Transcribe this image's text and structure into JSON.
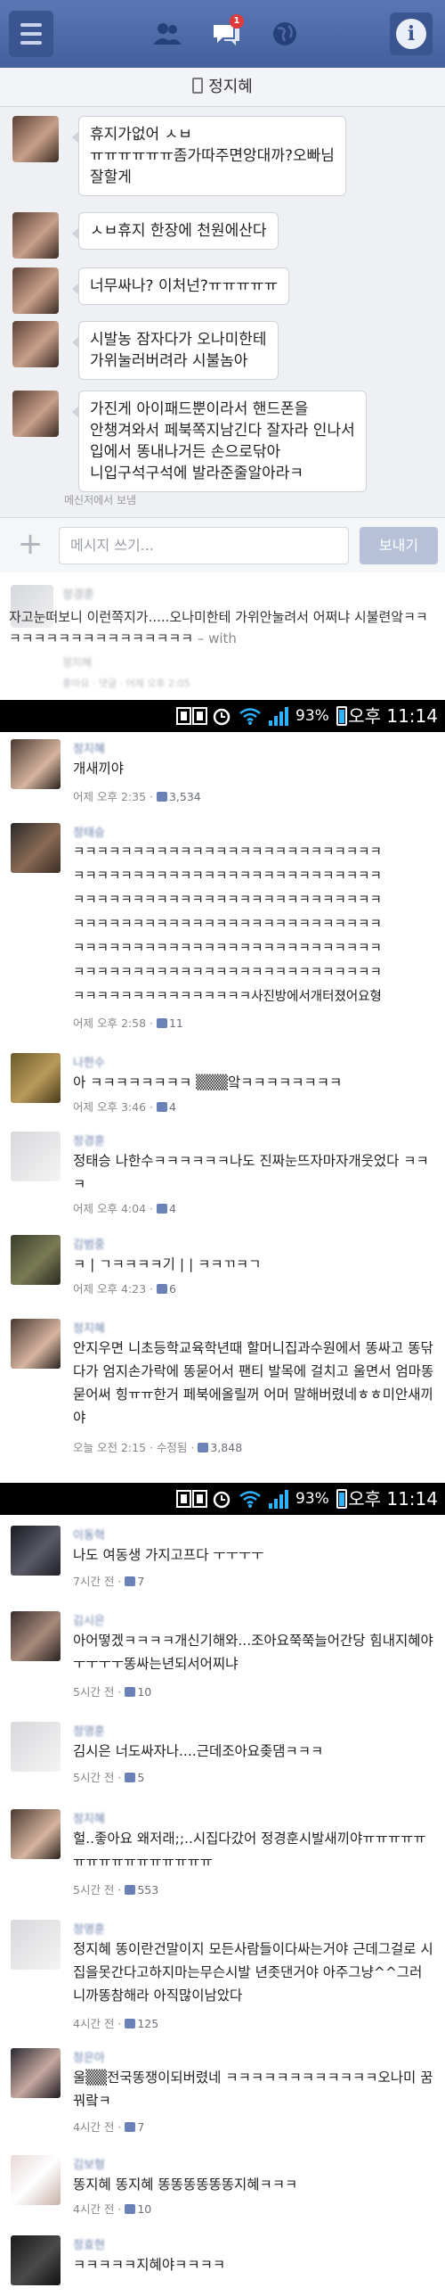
{
  "messenger": {
    "conversation_name": "정지혜",
    "notification_badge": "1",
    "messages": [
      "휴지가없어 ㅅㅂ\nㅠㅠㅠㅠㅠㅠ좀가따주면앙대까?오빠님\n잘할게",
      "ㅅㅂ휴지 한장에 천원에산다",
      "너무싸나? 이처넌?ㅠㅠㅠㅠㅠ",
      "시발농 잠자다가 오나미한테\n가위눌러버려라 시불놈아",
      "가진게 아이패드뿐이라서 핸드폰을\n안챙겨와서 페북쪽지남긴다 잘자라 인나서\n입에서 똥내나거든 손으로닦아\n니입구석구석에 발라준줄알아라ㅋ"
    ],
    "sent_from": "메신저에서 보냄",
    "composer_placeholder": "메시지 쓰기...",
    "send_label": "보내기"
  },
  "preview": {
    "name": "정경훈",
    "text": "자고눈떠보니 이런쪽지가.....오나미한테 가위안눌려서 어쩌냐 시불련앜ㅋㅋㅋㅋㅋㅋㅋㅋㅋㅋㅋㅋㅋㅋㅋㅋㅋ",
    "with": "– with",
    "sub": "정지혜",
    "meta": "좋아요 · 댓글 · 어제 오후 2:05"
  },
  "statusbars": [
    {
      "battery": "93%",
      "time": "오후 11:14"
    },
    {
      "battery": "93%",
      "time": "오후 11:14"
    }
  ],
  "comments_1": [
    {
      "name": "정지혜",
      "text": "개새끼야",
      "time": "어제 오후 2:35",
      "likes": "3,534"
    },
    {
      "name": "정태승",
      "text": "ㅋㅋㅋㅋㅋㅋㅋㅋㅋㅋㅋㅋㅋㅋㅋㅋㅋㅋㅋㅋㅋㅋㅋㅋㅋㅋ\nㅋㅋㅋㅋㅋㅋㅋㅋㅋㅋㅋㅋㅋㅋㅋㅋㅋㅋㅋㅋㅋㅋㅋㅋㅋㅋ\nㅋㅋㅋㅋㅋㅋㅋㅋㅋㅋㅋㅋㅋㅋㅋㅋㅋㅋㅋㅋㅋㅋㅋㅋㅋㅋ\nㅋㅋㅋㅋㅋㅋㅋㅋㅋㅋㅋㅋㅋㅋㅋㅋㅋㅋㅋㅋㅋㅋㅋㅋㅋㅋ\nㅋㅋㅋㅋㅋㅋㅋㅋㅋㅋㅋㅋㅋㅋㅋㅋㅋㅋㅋㅋㅋㅋㅋㅋㅋㅋ\nㅋㅋㅋㅋㅋㅋㅋㅋㅋㅋㅋㅋㅋㅋㅋㅋㅋㅋㅋㅋㅋㅋㅋㅋㅋㅋ\nㅋㅋㅋㅋㅋㅋㅋㅋㅋㅋㅋㅋㅋㅋㅋ사진방에서개터졌어요형",
      "time": "어제 오후 2:58",
      "likes": "11"
    },
    {
      "name": "나한수",
      "text": "아 ㅋㅋㅋㅋㅋㅋㅋㅋ ▒▒▒앜ㅋㅋㅋㅋㅋㅋㅋㅋ",
      "time": "어제 오후 3:46",
      "likes": "4"
    },
    {
      "name": "정경훈",
      "text": "정태승 나한수ㅋㅋㅋㅋㅋㅋ나도 진짜눈뜨자마자개웃었다 ㅋㅋㅋ",
      "time": "어제 오후 4:04",
      "likes": "4"
    },
    {
      "name": "김범중",
      "text": "ㅋ | ㄱㅋㅋㅋㅋ기 | | ㅋㅋㄲㅋㄱ",
      "time": "어제 오후 4:23",
      "likes": "6"
    },
    {
      "name": "정지혜",
      "text": "안지우면 니초등학교육학년때 할머니집과수원에서 똥싸고 똥닦다가 엄지손가락에 똥묻어서 팬티 발목에 걸치고 울면서 엄마똥묻어써 힝ㅠㅠ한거 페북에올릴꺼 어머 말해버렸네ㅎㅎ미안새끼야",
      "time": "오늘 오전 2:15 · 수정됨",
      "likes": "3,848"
    }
  ],
  "comments_2": [
    {
      "name": "이동혁",
      "text": "나도 여동생 가지고프다 ㅜㅜㅜㅜ",
      "time": "7시간 전",
      "likes": "7"
    },
    {
      "name": "김시은",
      "text": "아어떻겠ㅋㅋㅋㅋ개신기해와...조아요쭉쭉늘어간당 힘내지혜야ㅜㅜㅜㅜ똥싸는년되서어찌냐",
      "time": "5시간 전",
      "likes": "10"
    },
    {
      "name": "정영훈",
      "text": "김시은 너도싸자나....근데조아요좆댐ㅋㅋㅋ",
      "time": "5시간 전",
      "likes": "5"
    },
    {
      "name": "정지혜",
      "text": "헐..좋아요 왜저래;;..시집다갔어 정경훈시발새끼야ㅠㅠㅠㅠㅠㅠㅠㅠㅠㅠㅠㅠㅠㅠㅠㅠ",
      "time": "5시간 전",
      "likes": "553"
    },
    {
      "name": "정영훈",
      "text": "정지혜 똥이란건말이지 모든사람들이다싸는거야 근데그걸로 시집을못간다고하지마는무슨시발 년좃댄거야 아주그냥^^그러니까똥참해라 아직많이남았다",
      "time": "4시간 전",
      "likes": "125"
    },
    {
      "name": "정은아",
      "text": "울▒▒전국똥쟁이되버렸네 ㅋㅋㅋㅋㅋㅋㅋㅋㅋㅋㅋㅋ오나미 꿈꿔랔ㅋ",
      "time": "4시간 전",
      "likes": "7"
    },
    {
      "name": "김보형",
      "text": "똥지혜 똥지혜 똥똥똥똥똥똥지혜ㅋㅋㅋ",
      "time": "4시간 전",
      "likes": "10"
    },
    {
      "name": "정효현",
      "text": "ㅋㅋㅋㅋㅋ지혜야ㅋㅋㅋㅋ",
      "time": "",
      "likes": ""
    }
  ]
}
